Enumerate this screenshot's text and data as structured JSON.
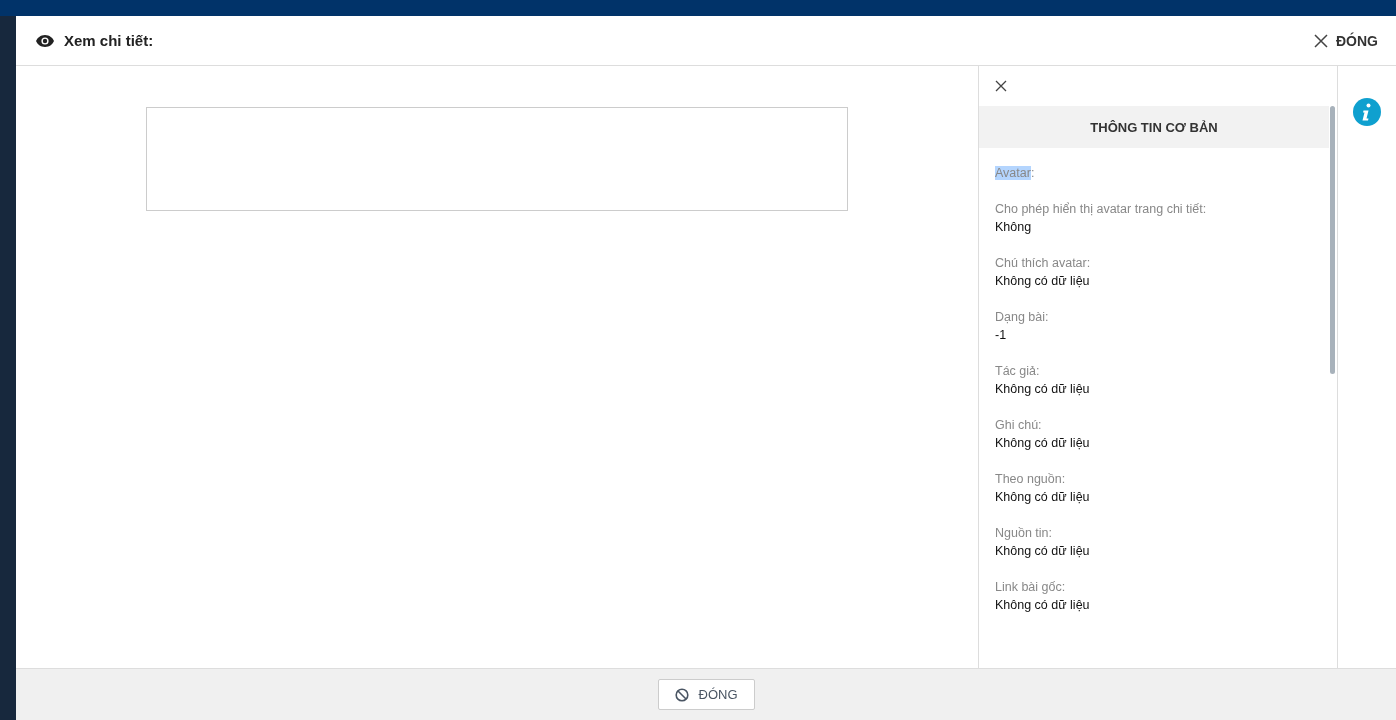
{
  "dialog": {
    "title": "Xem chi tiết:",
    "close_label": "ĐÓNG"
  },
  "info_panel": {
    "heading": "THÔNG TIN CƠ BẢN",
    "fields": [
      {
        "label": "Avatar:",
        "highlighted": true
      },
      {
        "label": "Cho phép hiển thị avatar trang chi tiết:",
        "value": "Không",
        "highlighted": false
      },
      {
        "label": "Chú thích avatar:",
        "value": "Không có dữ liệu",
        "highlighted": false
      },
      {
        "label": "Dạng bài:",
        "value": "-1",
        "highlighted": false
      },
      {
        "label": "Tác giả:",
        "value": "Không có dữ liệu",
        "highlighted": false
      },
      {
        "label": "Ghi chú:",
        "value": "Không có dữ liệu",
        "highlighted": false
      },
      {
        "label": "Theo nguồn:",
        "value": "Không có dữ liệu",
        "highlighted": false
      },
      {
        "label": "Nguồn tin:",
        "value": "Không có dữ liệu",
        "highlighted": false
      },
      {
        "label": "Link bài gốc:",
        "value": "Không có dữ liệu",
        "highlighted": false
      }
    ]
  },
  "footer": {
    "button_label": "ĐÓNG"
  }
}
